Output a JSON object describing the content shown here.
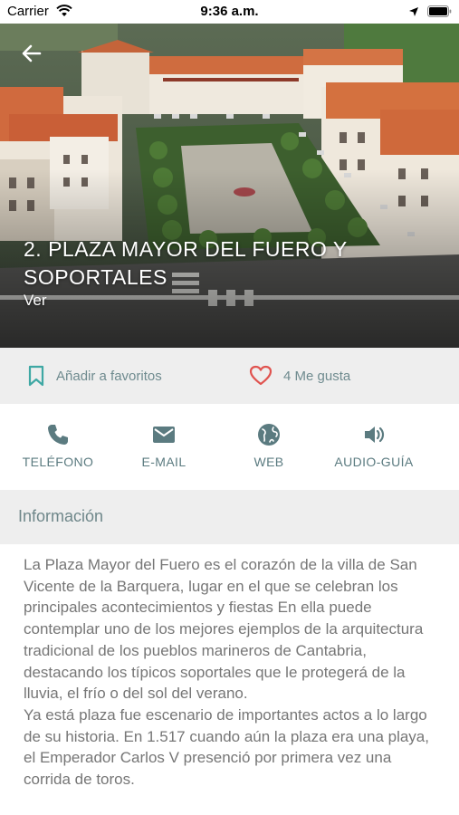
{
  "status_bar": {
    "carrier": "Carrier",
    "time": "9:36 a.m."
  },
  "hero": {
    "title": "2. PLAZA MAYOR DEL FUERO Y SOPORTALES",
    "link": "Ver"
  },
  "actions": {
    "favorite_label": "Añadir a favoritos",
    "likes_label": "4 Me gusta"
  },
  "contacts": [
    {
      "label": "TELÉFONO",
      "icon": "phone-icon"
    },
    {
      "label": "E-MAIL",
      "icon": "mail-icon"
    },
    {
      "label": "WEB",
      "icon": "globe-icon"
    },
    {
      "label": "AUDIO-GUÍA",
      "icon": "speaker-icon"
    }
  ],
  "info": {
    "header": "Información",
    "paragraph_1": "La Plaza Mayor del Fuero es el corazón de la villa de San Vicente de la Barquera, lugar en el que se celebran los principales acontecimientos y fiestas En ella puede contemplar uno de los mejores ejemplos de la arquitectura tradicional de los pueblos marineros de Cantabria, destacando los típicos soportales que le protegerá de la lluvia, el frío o del sol del verano.",
    "paragraph_2": "Ya está plaza fue escenario de importantes actos a lo largo de su historia. En 1.517 cuando aún la plaza era una playa, el Emperador Carlos V presenció por primera vez una corrida de toros."
  },
  "colors": {
    "accent_teal": "#3fa8a4",
    "heart_red": "#e0534f",
    "icon_slate": "#5b7b80",
    "section_bg": "#eeeeee"
  }
}
